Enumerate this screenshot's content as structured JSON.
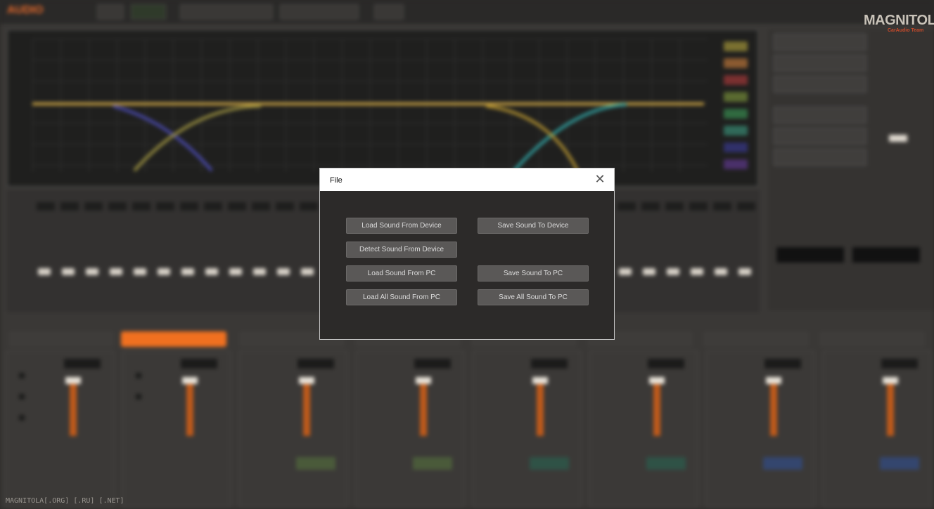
{
  "dialog": {
    "title": "File",
    "close_icon": "close-icon",
    "buttons": {
      "load_sound_from_device": "Load Sound From Device",
      "save_sound_to_device": "Save Sound To Device",
      "detect_sound_from_device": "Detect Sound From Device",
      "load_sound_from_pc": "Load Sound From PC",
      "save_sound_to_pc": "Save Sound To PC",
      "load_all_sound_from_pc": "Load All Sound From PC",
      "save_all_sound_to_pc": "Save All Sound To PC"
    }
  },
  "watermark": {
    "brand": "MAGNITOLA",
    "sub": "CarAudio Team",
    "footer": "MAGNITOLA[.ORG] [.RU] [.NET]"
  },
  "colors": {
    "accent": "#f07020",
    "dialog_bg": "#2c2a29",
    "button_bg": "#5a5857"
  }
}
